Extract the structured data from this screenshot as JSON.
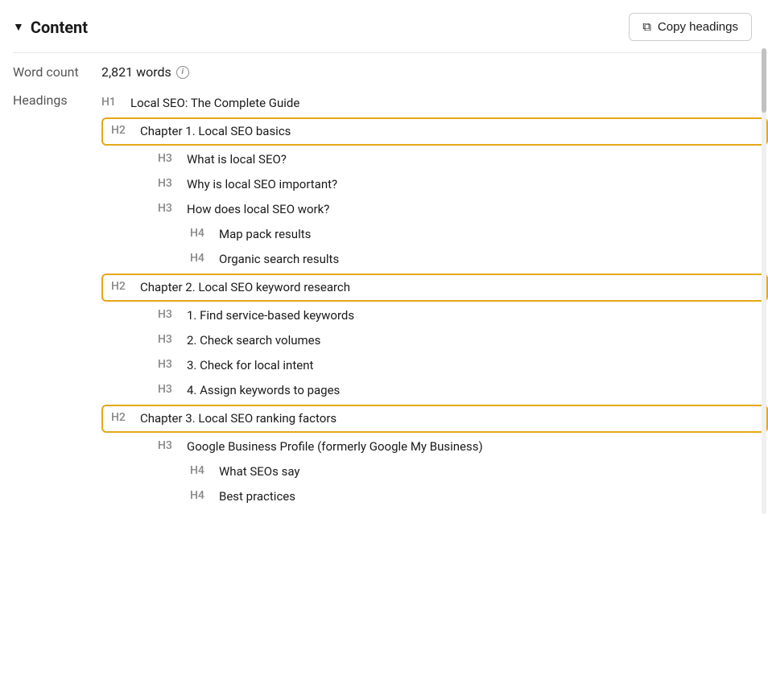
{
  "header": {
    "title": "Content",
    "copy_button_label": "Copy headings",
    "chevron": "▼"
  },
  "word_count": {
    "label": "Word count",
    "value": "2,821 words",
    "info_symbol": "i"
  },
  "headings_label": "Headings",
  "headings": [
    {
      "level": "H1",
      "text": "Local SEO: The Complete Guide",
      "indent": "h1",
      "highlight": false
    },
    {
      "level": "H2",
      "text": "Chapter 1. Local SEO basics",
      "indent": "h2",
      "highlight": true
    },
    {
      "level": "H3",
      "text": "What is local SEO?",
      "indent": "h3",
      "highlight": false
    },
    {
      "level": "H3",
      "text": "Why is local SEO important?",
      "indent": "h3",
      "highlight": false
    },
    {
      "level": "H3",
      "text": "How does local SEO work?",
      "indent": "h3",
      "highlight": false
    },
    {
      "level": "H4",
      "text": "Map pack results",
      "indent": "h4",
      "highlight": false
    },
    {
      "level": "H4",
      "text": "Organic search results",
      "indent": "h4",
      "highlight": false
    },
    {
      "level": "H2",
      "text": "Chapter 2. Local SEO keyword research",
      "indent": "h2",
      "highlight": true
    },
    {
      "level": "H3",
      "text": "1. Find service-based keywords",
      "indent": "h3",
      "highlight": false
    },
    {
      "level": "H3",
      "text": "2. Check search volumes",
      "indent": "h3",
      "highlight": false
    },
    {
      "level": "H3",
      "text": "3. Check for local intent",
      "indent": "h3",
      "highlight": false
    },
    {
      "level": "H3",
      "text": "4. Assign keywords to pages",
      "indent": "h3",
      "highlight": false
    },
    {
      "level": "H2",
      "text": "Chapter 3. Local SEO ranking factors",
      "indent": "h2",
      "highlight": true
    },
    {
      "level": "H3",
      "text": "Google Business Profile (formerly Google My Business)",
      "indent": "h3",
      "highlight": false
    },
    {
      "level": "H4",
      "text": "What SEOs say",
      "indent": "h4",
      "highlight": false
    },
    {
      "level": "H4",
      "text": "Best practices",
      "indent": "h4",
      "highlight": false
    }
  ],
  "colors": {
    "highlight_border": "#e6a817",
    "tag_color": "#888888",
    "label_color": "#555555"
  }
}
